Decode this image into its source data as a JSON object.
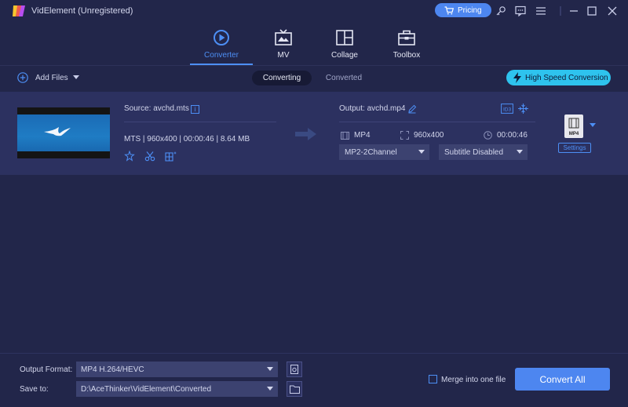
{
  "app": {
    "title": "VidElement (Unregistered)",
    "logo_icon": "videlement-logo-icon"
  },
  "titlebar": {
    "pricing_label": "Pricing",
    "icons": [
      "key-icon",
      "chat-icon",
      "menu-icon",
      "minimize-icon",
      "maximize-icon",
      "close-icon"
    ]
  },
  "nav": {
    "tabs": [
      {
        "label": "Converter",
        "icon": "converter-icon",
        "active": true
      },
      {
        "label": "MV",
        "icon": "mv-icon",
        "active": false
      },
      {
        "label": "Collage",
        "icon": "collage-icon",
        "active": false
      },
      {
        "label": "Toolbox",
        "icon": "toolbox-icon",
        "active": false
      }
    ]
  },
  "toolbar": {
    "add_files_label": "Add Files",
    "tab_converting": "Converting",
    "tab_converted": "Converted",
    "high_speed_label": "High Speed Conversion"
  },
  "file": {
    "source_label": "Source: avchd.mts",
    "source_meta": "MTS | 960x400 | 00:00:46 | 8.64 MB",
    "output_label": "Output: avchd.mp4",
    "out_format": "MP4",
    "out_resolution": "960x400",
    "out_duration": "00:00:46",
    "audio_track": "MP2-2Channel",
    "subtitle": "Subtitle Disabled",
    "format_badge": "MP4",
    "settings_label": "Settings"
  },
  "bottom": {
    "output_format_label": "Output Format:",
    "output_format_value": "MP4 H.264/HEVC",
    "save_to_label": "Save to:",
    "save_to_value": "D:\\AceThinker\\VidElement\\Converted",
    "merge_label": "Merge into one file",
    "merge_checked": false,
    "convert_all_label": "Convert All"
  },
  "colors": {
    "accent": "#4d86f0",
    "high_speed": "#2ec3ee",
    "background": "#22264a",
    "row_background": "#2c3160"
  }
}
